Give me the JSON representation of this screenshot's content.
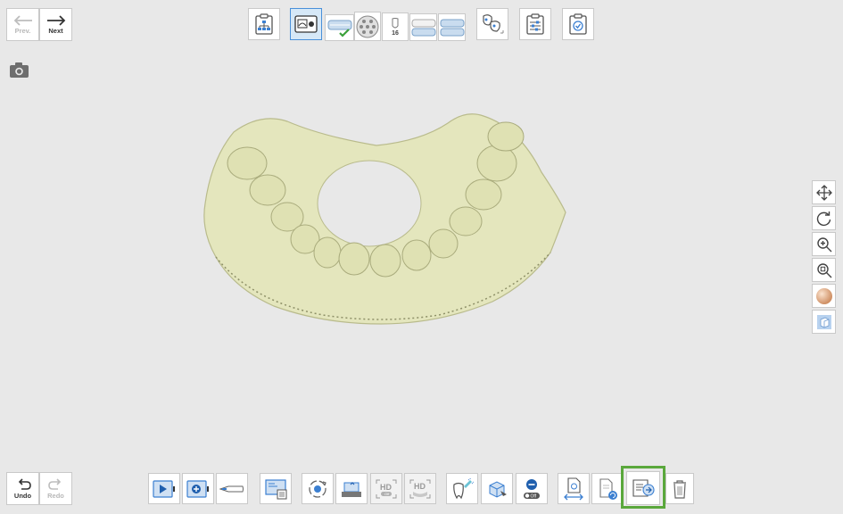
{
  "nav": {
    "prev_label": "Prev.",
    "next_label": "Next"
  },
  "history": {
    "undo_label": "Undo",
    "redo_label": "Redo"
  },
  "top_toolbar": {
    "tooth_number": "16",
    "icons": [
      "workflow-icon",
      "scan-stage-icon",
      "arch-select-icon",
      "tooth-grid-icon",
      "tooth-number-icon",
      "occlusion-icon",
      "bite-icon",
      "tooth-compare-icon",
      "settings-sliders-icon",
      "clipboard-check-icon"
    ]
  },
  "bottom_toolbar": {
    "hd_label": "HD",
    "hd_state": "Off",
    "mode_off_label": "Off",
    "highlighted_tool": "scan-data-transfer-icon"
  },
  "view_controls": [
    "pan-icon",
    "rotate-icon",
    "zoom-icon",
    "zoom-fit-icon",
    "texture-icon",
    "reliability-map-icon"
  ],
  "colors": {
    "background": "#e8e8e8",
    "accent": "#4a90d9",
    "highlight": "#5aa83c",
    "model": "#e4e6bd"
  }
}
